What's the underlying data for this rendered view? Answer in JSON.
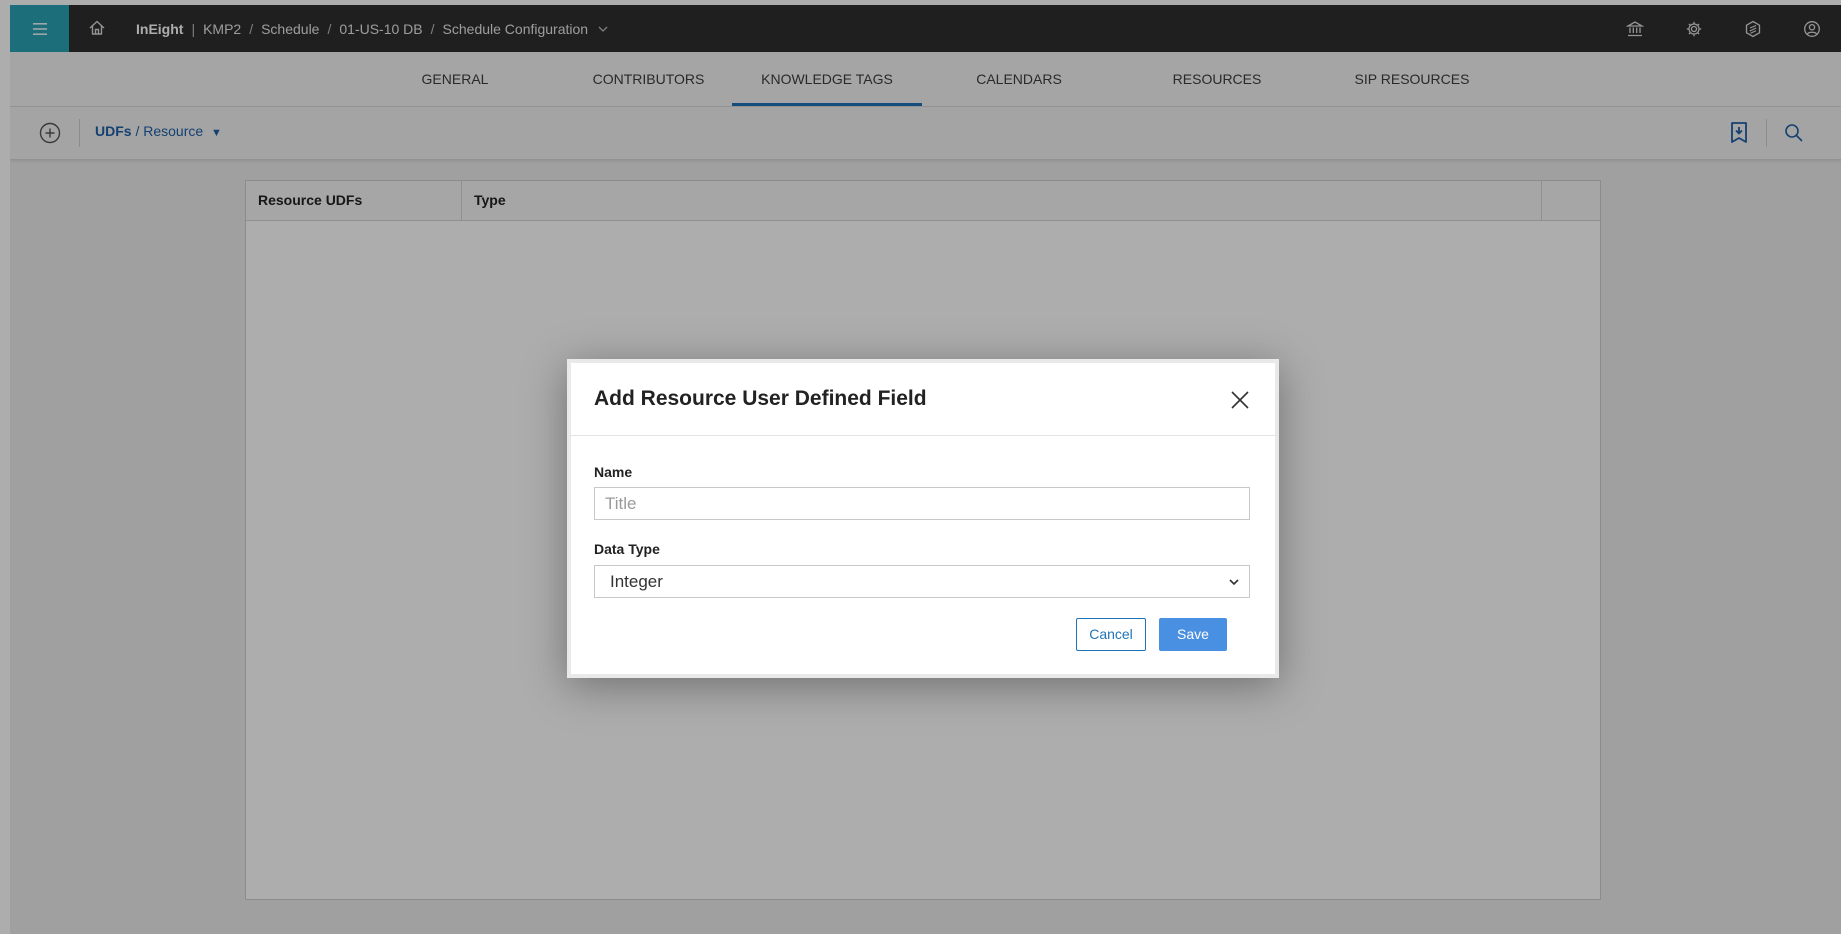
{
  "topbar": {
    "brand": "InEight",
    "crumbs": [
      "KMP2",
      "Schedule",
      "01-US-10 DB",
      "Schedule Configuration"
    ],
    "icons": [
      "hamburger-icon",
      "home-icon",
      "institution-icon",
      "settings-icon",
      "hexagon-icon",
      "user-icon"
    ]
  },
  "tabs": [
    "GENERAL",
    "CONTRIBUTORS",
    "KNOWLEDGE TAGS",
    "CALENDARS",
    "RESOURCES",
    "SIP RESOURCES"
  ],
  "active_tab": "KNOWLEDGE TAGS",
  "toolbar": {
    "udfs": "UDFs",
    "separator": " / ",
    "section": "Resource",
    "dropdown_glyph": "▼"
  },
  "grid": {
    "columns": [
      "Resource UDFs",
      "Type",
      ""
    ]
  },
  "modal": {
    "title": "Add Resource User Defined Field",
    "name_label": "Name",
    "name_placeholder": "Title",
    "name_value": "",
    "data_type_label": "Data Type",
    "data_type_value": "Integer",
    "cancel_label": "Cancel",
    "save_label": "Save"
  },
  "colors": {
    "accent": "#1f73b7",
    "hamburger_bg": "#2aa3b5",
    "topbar_bg": "#2f2f2f",
    "save_bg": "#4a90e2"
  }
}
